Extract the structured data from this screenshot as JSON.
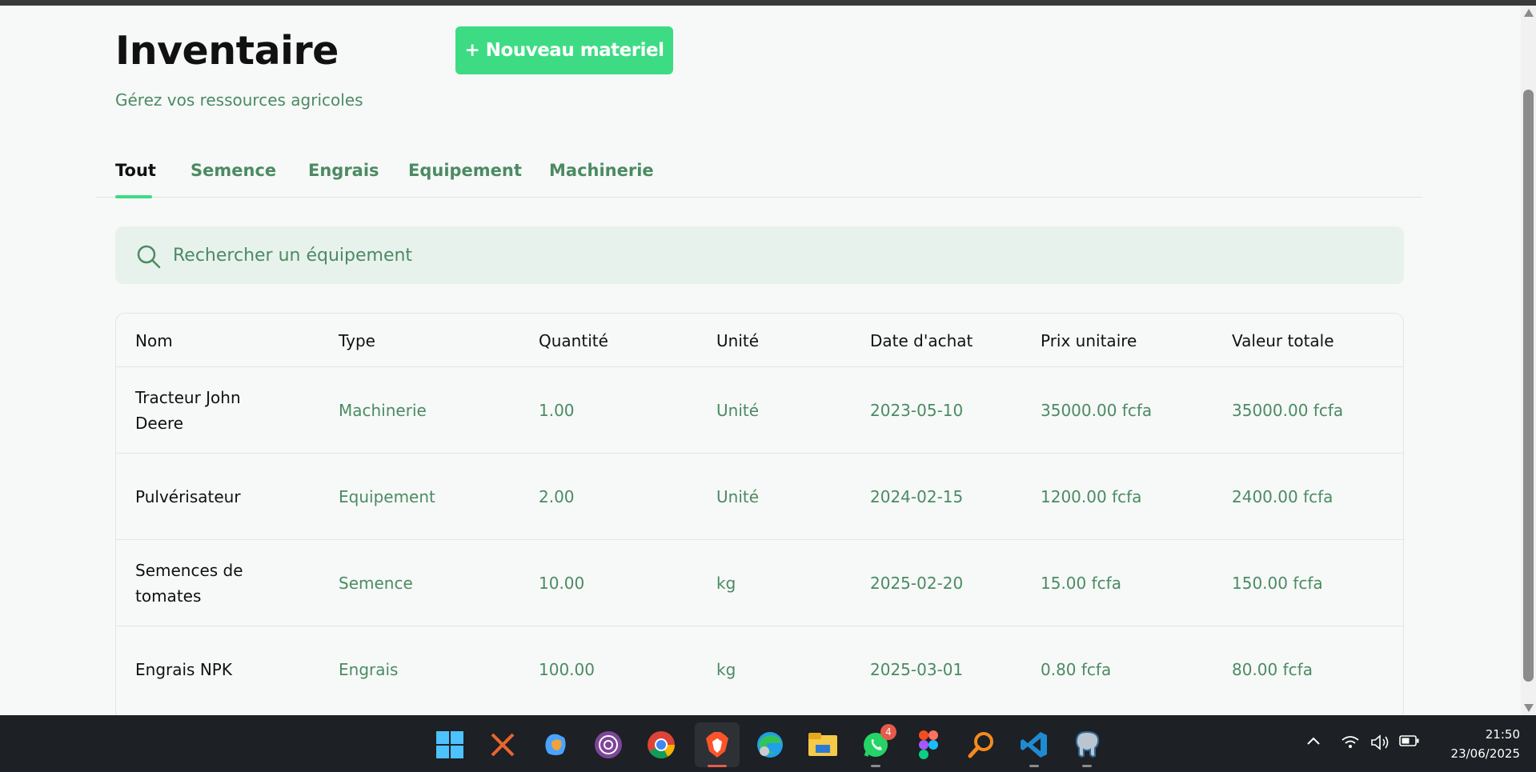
{
  "header": {
    "title": "Inventaire",
    "subtitle": "Gérez vos ressources agricoles",
    "new_button_label": "+ Nouveau materiel"
  },
  "tabs": [
    {
      "label": "Tout",
      "active": true
    },
    {
      "label": "Semence",
      "active": false
    },
    {
      "label": "Engrais",
      "active": false
    },
    {
      "label": "Equipement",
      "active": false
    },
    {
      "label": "Machinerie",
      "active": false
    }
  ],
  "search": {
    "placeholder": "Rechercher un équipement",
    "value": ""
  },
  "table": {
    "columns": [
      "Nom",
      "Type",
      "Quantité",
      "Unité",
      "Date d'achat",
      "Prix unitaire",
      "Valeur totale"
    ],
    "rows": [
      {
        "nom": "Tracteur John Deere",
        "type": "Machinerie",
        "quantite": "1.00",
        "unite": "Unité",
        "date": "2023-05-10",
        "prix": "35000.00 fcfa",
        "valeur": "35000.00 fcfa"
      },
      {
        "nom": "Pulvérisateur",
        "type": "Equipement",
        "quantite": "2.00",
        "unite": "Unité",
        "date": "2024-02-15",
        "prix": "1200.00 fcfa",
        "valeur": "2400.00 fcfa"
      },
      {
        "nom": "Semences de tomates",
        "type": "Semence",
        "quantite": "10.00",
        "unite": "kg",
        "date": "2025-02-20",
        "prix": "15.00 fcfa",
        "valeur": "150.00 fcfa"
      },
      {
        "nom": "Engrais NPK",
        "type": "Engrais",
        "quantite": "100.00",
        "unite": "kg",
        "date": "2025-03-01",
        "prix": "0.80 fcfa",
        "valeur": "80.00 fcfa"
      }
    ]
  },
  "taskbar": {
    "whatsapp_badge": "4",
    "time": "21:50",
    "date": "23/06/2025"
  },
  "colors": {
    "accent": "#3ddc84",
    "muted_green": "#4c8a63",
    "search_bg": "#e8f2ec",
    "page_bg": "#f6f9f7"
  }
}
